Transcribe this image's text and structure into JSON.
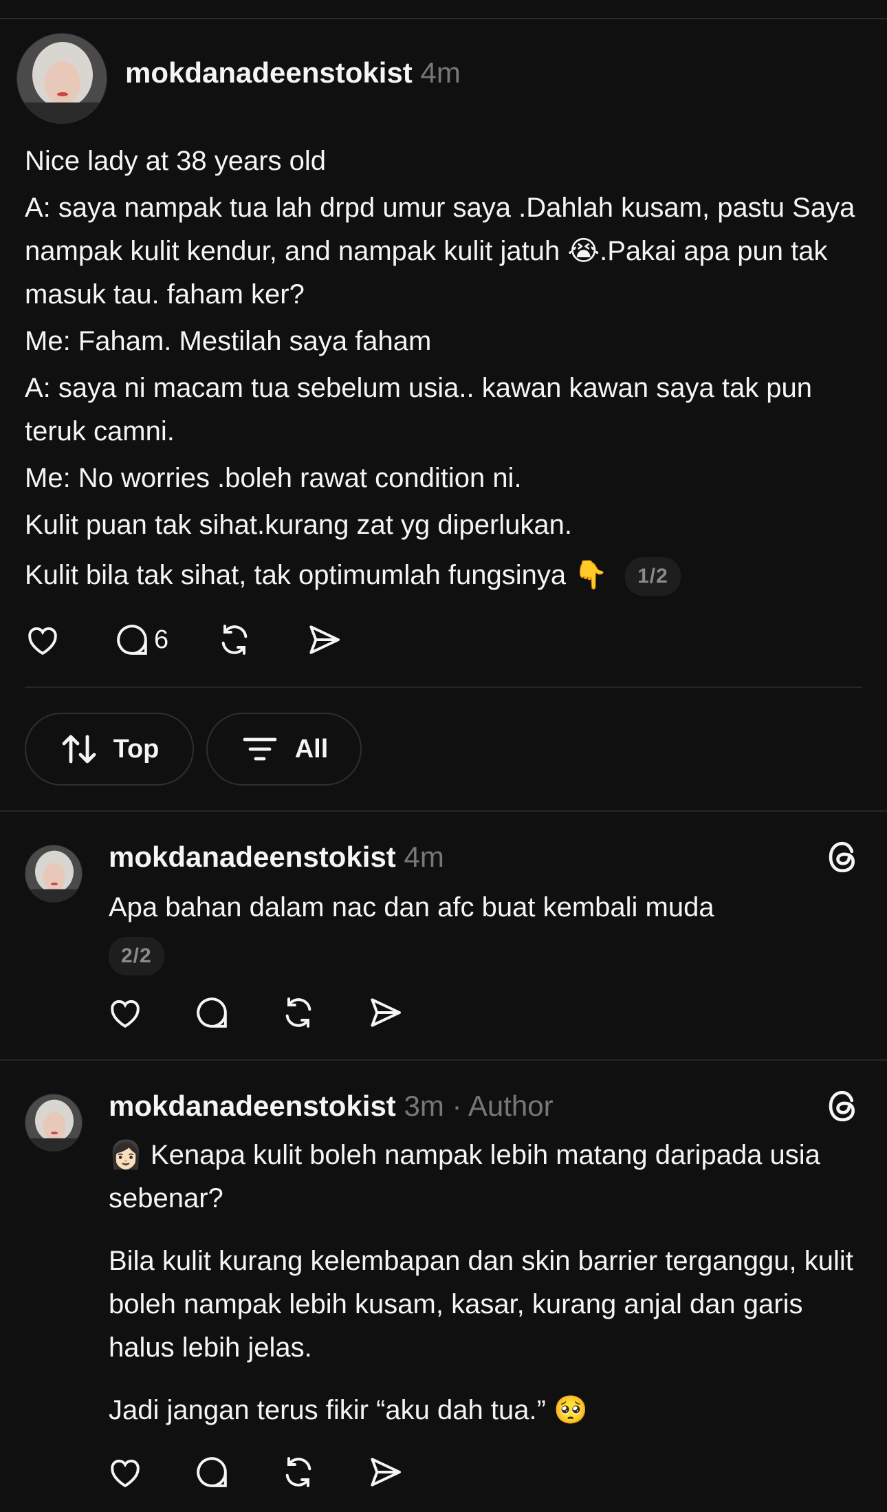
{
  "post": {
    "username": "mokdanadeenstokist",
    "time": "4m",
    "lines": [
      "Nice lady at 38 years old",
      "A: saya nampak tua lah drpd umur saya .Dahlah kusam, pastu Saya nampak kulit kendur, and nampak kulit jatuh 😭.Pakai apa pun tak masuk tau.  faham ker?",
      "Me: Faham. Mestilah saya faham",
      "A: saya ni macam tua sebelum usia.. kawan kawan saya tak pun teruk camni.",
      "Me: No worries .boleh rawat condition ni.",
      "Kulit puan tak sihat.kurang zat  yg diperlukan."
    ],
    "last_line": "Kulit bila tak sihat, tak optimumlah fungsinya 👇",
    "pager": "1/2",
    "reply_count": "6"
  },
  "sort": {
    "top_label": "Top",
    "all_label": "All"
  },
  "reply1": {
    "username": "mokdanadeenstokist",
    "time": "4m",
    "text": "Apa bahan dalam nac dan afc buat kembali muda",
    "pager": "2/2"
  },
  "reply2": {
    "username": "mokdanadeenstokist",
    "time": "3m",
    "author_tag": "· Author",
    "para1": "👩🏻 Kenapa kulit boleh nampak lebih matang daripada usia sebenar?",
    "para2": "Bila kulit kurang kelembapan dan skin barrier terganggu, kulit boleh nampak lebih kusam, kasar, kurang anjal dan garis halus lebih jelas.",
    "para3": "Jadi jangan terus fikir “aku dah tua.” 🥺"
  },
  "icons": {
    "like": "heart-icon",
    "reply": "comment-icon",
    "repost": "repost-icon",
    "share": "send-icon",
    "sort": "sort-arrows-icon",
    "filter": "filter-icon",
    "threads": "threads-logo-icon"
  },
  "colors": {
    "background": "#101010",
    "text": "#f3f5f7",
    "muted": "#777777",
    "divider": "#262626"
  }
}
